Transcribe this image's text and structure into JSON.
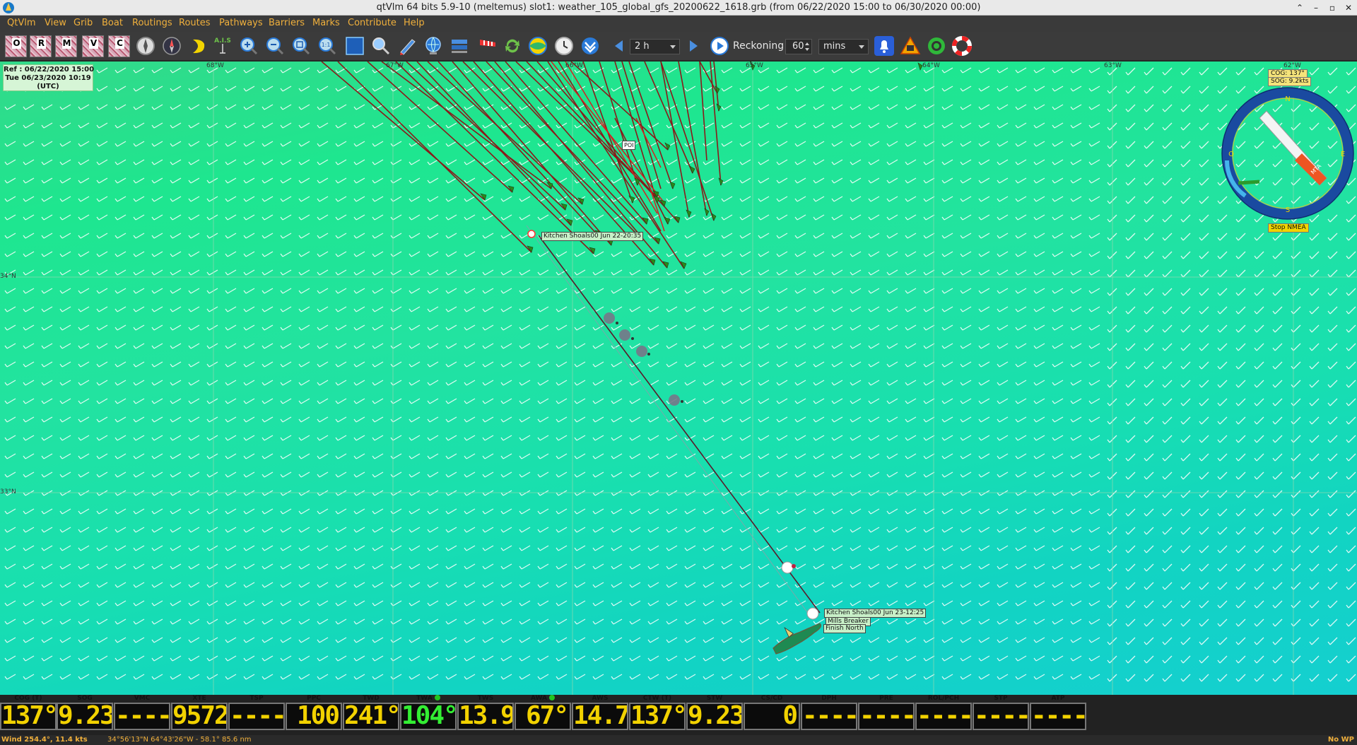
{
  "window": {
    "title": "qtVlm 64 bits 5.9-10 (meltemus) slot1: weather_105_global_gfs_20200622_1618.grb (from 06/22/2020 15:00 to 06/30/2020 00:00)",
    "controls": [
      "⌃",
      "–",
      "▫",
      "✕"
    ]
  },
  "menu": [
    "QtVlm",
    "View",
    "Grib",
    "Boat",
    "Routings",
    "Routes",
    "Pathways",
    "Barriers",
    "Marks",
    "Contribute",
    "Help"
  ],
  "toolbar": {
    "grib_buttons": [
      "O",
      "R",
      "M",
      "V",
      "C"
    ],
    "ais_label": "A.I.S",
    "step_value": "2 h",
    "reckoning_label": "Reckoning",
    "reckoning_value": "60",
    "reckoning_unit": "mins"
  },
  "map": {
    "ref": [
      "Ref : 06/22/2020 15:00",
      "Tue 06/23/2020 10:19",
      "(UTC)"
    ],
    "longitudes": [
      "68°W",
      "67°W",
      "66°W",
      "65°W",
      "64°W",
      "63°W",
      "62°W"
    ],
    "latitudes": [
      "34°N",
      "33°N"
    ],
    "labels": {
      "kitchen_top": "Kitchen Shoals00 Jun 22-20:35",
      "kitchen_bottom": "Kitchen Shoals00 Jun 23-12:25",
      "mills": "Mills Breaker",
      "finish": "Finish North",
      "poi": "POI"
    },
    "compass": {
      "cog": "COG: 137°",
      "sog": "SOG: 9.2kts",
      "stop_nmea": "Stop NMEA"
    }
  },
  "instruments": [
    {
      "label": "COG (T)",
      "value": "137°"
    },
    {
      "label": "SOG",
      "value": "9.23"
    },
    {
      "label": "VMC",
      "value": "----"
    },
    {
      "label": "XTE",
      "value": "9572"
    },
    {
      "label": "TSP",
      "value": "----"
    },
    {
      "label": "PPC",
      "value": "100"
    },
    {
      "label": "TWD",
      "value": "241°"
    },
    {
      "label": "TWA",
      "value": "104°",
      "indicator": "green"
    },
    {
      "label": "TWS",
      "value": "13.9"
    },
    {
      "label": "AWA",
      "value": "67°",
      "indicator": "green"
    },
    {
      "label": "AWS",
      "value": "14.7"
    },
    {
      "label": "CTW (T)",
      "value": "137°"
    },
    {
      "label": "STW",
      "value": "9.23"
    },
    {
      "label": "CS/CD",
      "value": "0"
    },
    {
      "label": "DPH",
      "value": "----"
    },
    {
      "label": "PRE",
      "value": "----"
    },
    {
      "label": "ROL/PCH",
      "value": "----"
    },
    {
      "label": "STP",
      "value": "----"
    },
    {
      "label": "ATP",
      "value": "----"
    }
  ],
  "status": {
    "wind": "Wind 254.4°, 11.4 kts",
    "position": "34°56'13\"N 64°43'26\"W - 58.1° 85.6 nm",
    "waypoint": "No WP"
  }
}
